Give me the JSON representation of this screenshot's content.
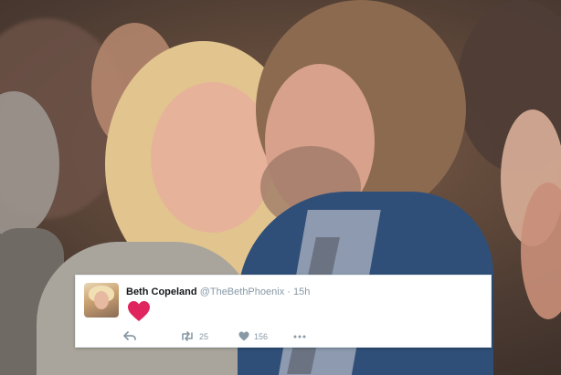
{
  "tweet": {
    "author_name": "Beth Copeland",
    "handle": "@TheBethPhoenix",
    "separator": "·",
    "time": "15h",
    "content_emoji": "heart-emoji",
    "heart_color": "#e0245e",
    "retweet_count": "25",
    "like_count": "156",
    "icons": [
      "reply-icon",
      "retweet-icon",
      "like-icon",
      "more-icon"
    ]
  },
  "colors": {
    "name": "#14171a",
    "meta": "#8899a6",
    "card_bg": "#ffffff"
  }
}
